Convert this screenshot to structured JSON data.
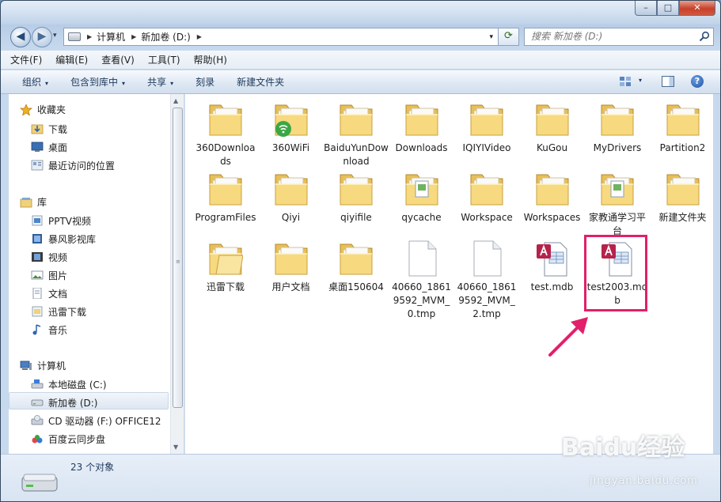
{
  "window": {
    "caption": {
      "minimize": "–",
      "maximize": "□",
      "close": "✕"
    }
  },
  "nav": {
    "back": "◀",
    "forward": "▶",
    "history": "▾",
    "breadcrumb": [
      "计算机",
      "新加卷 (D:)"
    ],
    "dropdown": "▾",
    "refresh": "⟳",
    "search_placeholder": "搜索 新加卷 (D:)"
  },
  "menubar": [
    "文件(F)",
    "编辑(E)",
    "查看(V)",
    "工具(T)",
    "帮助(H)"
  ],
  "cmdbar": {
    "organize": "组织",
    "include": "包含到库中",
    "share": "共享",
    "burn": "刻录",
    "new_folder": "新建文件夹",
    "arrow": "▾",
    "help": "?"
  },
  "navpane": {
    "favorites": {
      "title": "收藏夹",
      "items": [
        "下载",
        "桌面",
        "最近访问的位置"
      ]
    },
    "libraries": {
      "title": "库",
      "items": [
        "PPTV视频",
        "暴风影视库",
        "视频",
        "图片",
        "文档",
        "迅雷下载",
        "音乐"
      ]
    },
    "computer": {
      "title": "计算机",
      "items": [
        "本地磁盘 (C:)",
        "新加卷 (D:)",
        "CD 驱动器 (F:) OFFICE12",
        "百度云同步盘"
      ]
    }
  },
  "scrollbar": {
    "up": "▲",
    "down": "▼",
    "grip": "≡"
  },
  "files": [
    {
      "name": "360Downloads",
      "type": "folder"
    },
    {
      "name": "360WiFi",
      "type": "wifi-folder"
    },
    {
      "name": "BaiduYunDownload",
      "type": "folder"
    },
    {
      "name": "Downloads",
      "type": "folder"
    },
    {
      "name": "IQIYIVideo",
      "type": "folder"
    },
    {
      "name": "KuGou",
      "type": "folder"
    },
    {
      "name": "MyDrivers",
      "type": "folder"
    },
    {
      "name": "Partition2",
      "type": "folder"
    },
    {
      "name": "ProgramFiles",
      "type": "folder"
    },
    {
      "name": "Qiyi",
      "type": "folder"
    },
    {
      "name": "qiyifile",
      "type": "folder"
    },
    {
      "name": "qycache",
      "type": "folder-doc"
    },
    {
      "name": "Workspace",
      "type": "folder"
    },
    {
      "name": "Workspaces",
      "type": "folder"
    },
    {
      "name": "家教通学习平台",
      "type": "folder-doc"
    },
    {
      "name": "新建文件夹",
      "type": "folder"
    },
    {
      "name": "迅雷下载",
      "type": "folder-open"
    },
    {
      "name": "用户文档",
      "type": "folder"
    },
    {
      "name": "桌面150604",
      "type": "folder"
    },
    {
      "name": "40660_18619592_MVM_0.tmp",
      "type": "file"
    },
    {
      "name": "40660_18619592_MVM_2.tmp",
      "type": "file"
    },
    {
      "name": "test.mdb",
      "type": "mdb"
    },
    {
      "name": "test2003.mdb",
      "type": "mdb"
    }
  ],
  "details": {
    "count": "23 个对象"
  },
  "watermark": {
    "brand": "Baidu经验",
    "url": "jingyan.baidu.com"
  },
  "colors": {
    "highlight": "#e21f6a",
    "folder": "#f2d47a",
    "accent": "#1e395b"
  }
}
